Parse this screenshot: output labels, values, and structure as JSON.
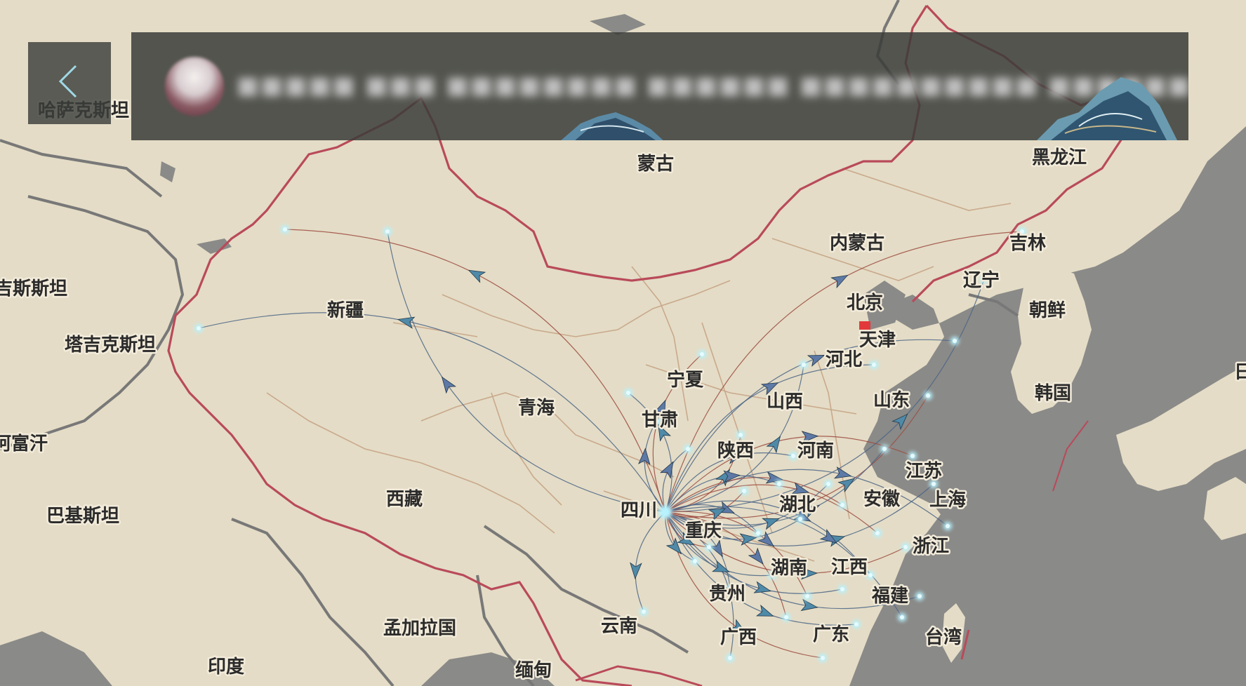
{
  "header": {
    "back_icon": "chevron-left-icon",
    "avatar_icon": "user-avatar",
    "title": "■■■■■ ■■■ ■■■■■■■■ ■■■■■■ ■■■■■■■■■■ ■■■■■■"
  },
  "map": {
    "colors": {
      "land": "#e4dcc6",
      "sea": "#8a8a88",
      "china_border": "#b94a5a",
      "province_border": "#c9a98c",
      "inner_line": "#6f7f8d",
      "flow_blue": "#4a6486",
      "flow_red": "#9c4a40",
      "arrow_fill": "#4f8aa8",
      "node_glow": "#b7f3ff"
    },
    "country_labels": {
      "kazakhstan": "哈萨克斯坦",
      "mongolia": "蒙古",
      "kyrgyzstan": "吉尔吉斯斯坦",
      "tajikistan": "塔吉克斯坦",
      "afghanistan": "阿富汗",
      "pakistan": "巴基斯坦",
      "india": "印度",
      "bangladesh": "孟加拉国",
      "myanmar": "缅甸",
      "north_korea": "朝鲜",
      "south_korea": "韩国",
      "japan": "日"
    },
    "province_labels": {
      "heilongjiang": "黑龙江",
      "inner_mongolia": "内蒙古",
      "jilin": "吉林",
      "liaoning": "辽宁",
      "beijing": "北京",
      "tianjin": "天津",
      "hebei": "河北",
      "shandong": "山东",
      "shanxi": "山西",
      "ningxia": "宁夏",
      "gansu": "甘肃",
      "xinjiang": "新疆",
      "qinghai": "青海",
      "xizang": "西藏",
      "sichuan": "四川",
      "chongqing": "重庆",
      "shaanxi": "陕西",
      "henan": "河南",
      "hubei": "湖北",
      "anhui": "安徽",
      "jiangsu": "江苏",
      "shanghai": "上海",
      "zhejiang": "浙江",
      "jiangxi": "江西",
      "hunan": "湖南",
      "guizhou": "贵州",
      "yunnan": "云南",
      "guangxi": "广西",
      "guangdong": "广东",
      "fujian": "福建",
      "taiwan": "台湾"
    },
    "flow_origin": "四川"
  }
}
